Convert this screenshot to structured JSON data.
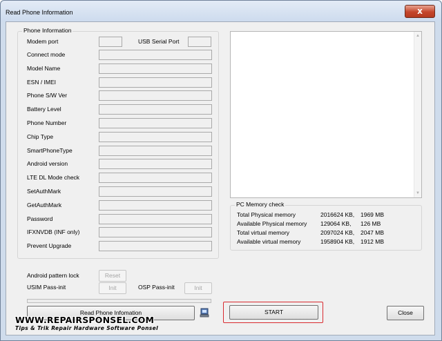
{
  "window": {
    "title": "Read Phone Information",
    "close_glyph": "x"
  },
  "phone_info": {
    "group_title": "Phone Information",
    "modem_port_label": "Modem port",
    "usb_port_label": "USB Serial Port",
    "fields": [
      "Connect mode",
      "Model Name",
      "ESN / IMEI",
      "Phone S/W Ver",
      "Battery Level",
      "Phone Number",
      "Chip Type",
      "SmartPhoneType",
      "Android version",
      "LTE DL Mode check",
      "SetAuthMark",
      "GetAuthMark",
      "Password",
      "IFXNVDB (INF only)",
      "Prevent Upgrade"
    ],
    "android_pattern_lock_label": "Android pattern lock",
    "reset_label": "Reset",
    "usim_label": "USIM Pass-init",
    "osp_label": "OSP Pass-init",
    "init_label": "Init"
  },
  "actions": {
    "read_label": "Read Phone Infomation",
    "start_label": "START",
    "close_label": "Close",
    "phone_icon": "phone-icon"
  },
  "pc_memory": {
    "group_title": "PC Memory check",
    "rows": [
      {
        "label": "Total Physical memory",
        "kb": "2016624 KB,",
        "mb": "1969 MB"
      },
      {
        "label": "Available Physical memory",
        "kb": "129064 KB,",
        "mb": "126 MB"
      },
      {
        "label": "Total virtual memory",
        "kb": "2097024 KB,",
        "mb": "2047 MB"
      },
      {
        "label": "Available virtual memory",
        "kb": "1958904 KB,",
        "mb": "1912 MB"
      }
    ]
  },
  "watermark": {
    "site": "WWW.REPAIRSPONSEL.COM",
    "tagline": "Tips & Trik Repair Hardware Software Ponsel"
  },
  "colors": {
    "start_highlight": "#d9292e",
    "title_close": "#c4462c"
  }
}
